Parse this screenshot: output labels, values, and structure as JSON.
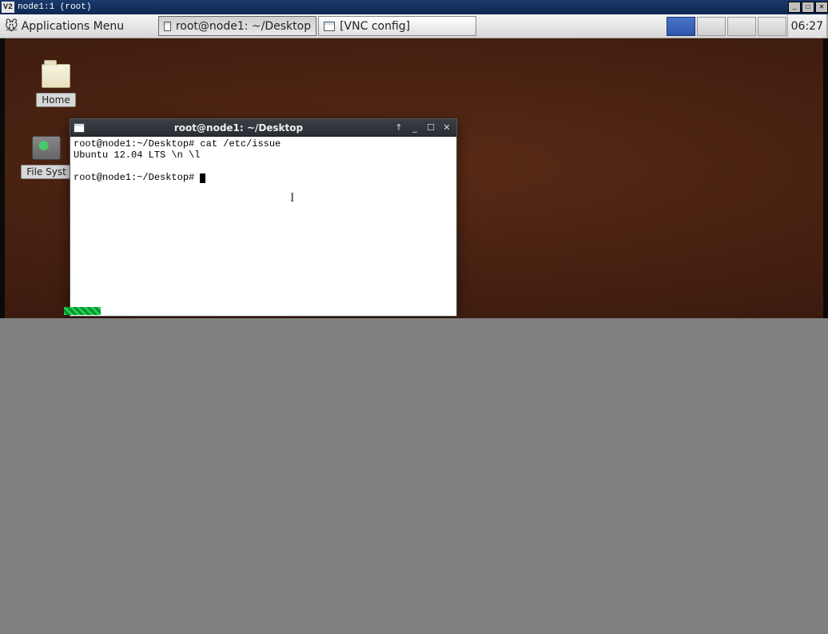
{
  "vnc": {
    "title": "node1:1 (root)",
    "logo": "V2"
  },
  "panel": {
    "apps_menu_label": "Applications Menu",
    "task1_label": "root@node1: ~/Desktop",
    "task2_label": "[VNC config]",
    "clock": "06:27"
  },
  "desktop": {
    "icon_home_label": "Home",
    "icon_filesystem_label": "File Syst"
  },
  "terminal": {
    "title": "root@node1: ~/Desktop",
    "line1_prompt": "root@node1:~/Desktop#",
    "line1_cmd": " cat /etc/issue",
    "line2": "Ubuntu 12.04 LTS \\n \\l",
    "line4_prompt": "root@node1:~/Desktop# "
  }
}
